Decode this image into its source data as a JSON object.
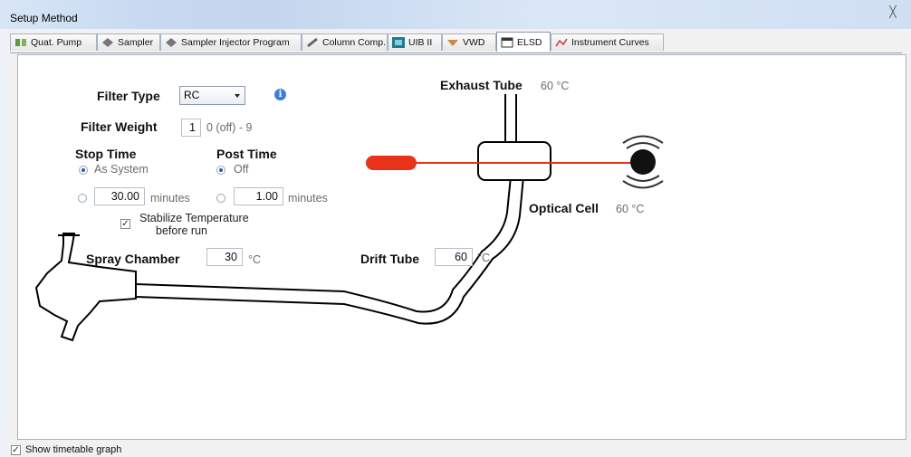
{
  "window": {
    "title": "Setup Method",
    "close_glyph": "╳"
  },
  "tabs": [
    {
      "label": "Quat. Pump",
      "icon": "pump-icon"
    },
    {
      "label": "Sampler",
      "icon": "sampler-icon"
    },
    {
      "label": "Sampler Injector Program",
      "icon": "sampler-icon"
    },
    {
      "label": "Column Comp.",
      "icon": "column-icon"
    },
    {
      "label": "UIB II",
      "icon": "uib-icon"
    },
    {
      "label": "VWD",
      "icon": "vwd-icon"
    },
    {
      "label": "ELSD",
      "icon": "elsd-icon",
      "active": true
    },
    {
      "label": "Instrument Curves",
      "icon": "curves-icon"
    }
  ],
  "filter": {
    "type_label": "Filter Type",
    "type_value": "RC",
    "weight_label": "Filter Weight",
    "weight_value": "1",
    "weight_range": "0 (off) - 9"
  },
  "stop_time": {
    "label": "Stop Time",
    "as_system": "As System",
    "value": "30.00",
    "unit": "minutes"
  },
  "post_time": {
    "label": "Post Time",
    "off": "Off",
    "value": "1.00",
    "unit": "minutes"
  },
  "stabilize": {
    "line1": "Stabilize Temperature",
    "line2": "before run",
    "checked": true
  },
  "spray_chamber": {
    "label": "Spray Chamber",
    "value": "30",
    "unit": "°C"
  },
  "drift_tube": {
    "label": "Drift Tube",
    "value": "60",
    "unit": "°C"
  },
  "exhaust_tube": {
    "label": "Exhaust Tube",
    "temp": "60 °C"
  },
  "optical_cell": {
    "label": "Optical Cell",
    "temp": "60 °C"
  },
  "footer": {
    "show_timetable": "Show timetable graph",
    "checked": true
  },
  "colors": {
    "laser": "#e8321a",
    "accent": "#3d7fd6"
  }
}
